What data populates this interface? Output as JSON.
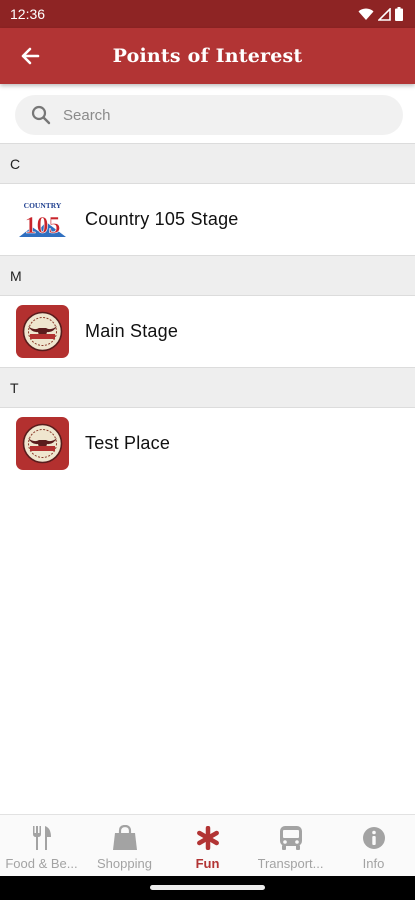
{
  "status_bar": {
    "time": "12:36"
  },
  "app_bar": {
    "title": "Points of Interest"
  },
  "search": {
    "placeholder": "Search",
    "value": ""
  },
  "sections": [
    {
      "letter": "C",
      "items": [
        {
          "label": "Country 105 Stage",
          "logo_text_top": "COUNTRY",
          "logo_text_main": "105"
        }
      ]
    },
    {
      "letter": "M",
      "items": [
        {
          "label": "Main Stage"
        }
      ]
    },
    {
      "letter": "T",
      "items": [
        {
          "label": "Test Place"
        }
      ]
    }
  ],
  "bottom_nav": {
    "items": [
      {
        "label": "Food & Be...",
        "icon": "fork-knife-icon"
      },
      {
        "label": "Shopping",
        "icon": "shopping-bag-icon"
      },
      {
        "label": "Fun",
        "icon": "asterisk-icon",
        "active": true
      },
      {
        "label": "Transport...",
        "icon": "bus-icon"
      },
      {
        "label": "Info",
        "icon": "info-icon"
      }
    ]
  },
  "colors": {
    "primary": "#b23434",
    "status_bar": "#8e2424",
    "inactive": "#a3a3a3"
  }
}
